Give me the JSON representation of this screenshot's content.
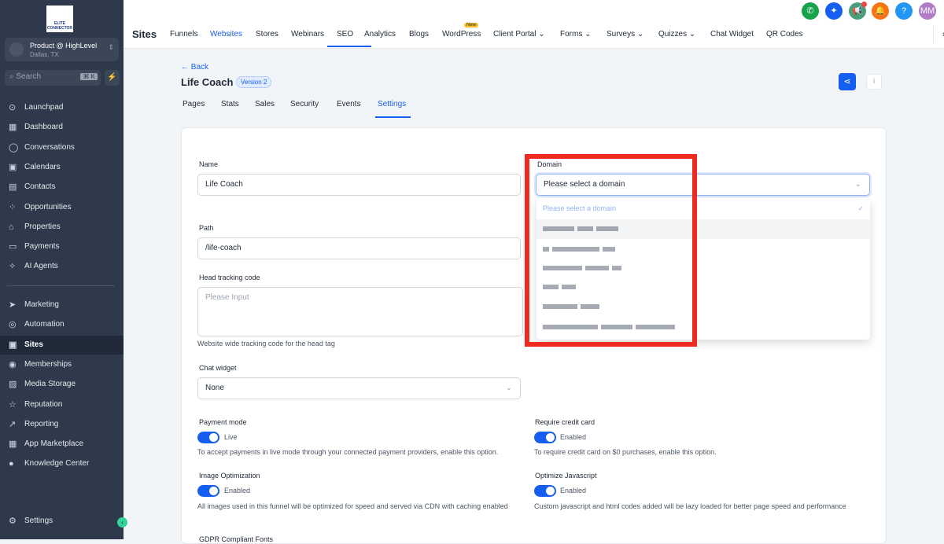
{
  "sidebar": {
    "logo_text": "ELITE CONNECTOR",
    "account": {
      "name": "Product @ HighLevel",
      "location": "Dallas, TX"
    },
    "search": {
      "placeholder": "Search",
      "shortcut": "⌘ K"
    },
    "items": [
      {
        "label": "Launchpad",
        "icon": "⊙"
      },
      {
        "label": "Dashboard",
        "icon": "▦"
      },
      {
        "label": "Conversations",
        "icon": "◯"
      },
      {
        "label": "Calendars",
        "icon": "▣"
      },
      {
        "label": "Contacts",
        "icon": "▤"
      },
      {
        "label": "Opportunities",
        "icon": "⁘"
      },
      {
        "label": "Properties",
        "icon": "⌂"
      },
      {
        "label": "Payments",
        "icon": "▭"
      },
      {
        "label": "AI Agents",
        "icon": "✧"
      }
    ],
    "items2": [
      {
        "label": "Marketing",
        "icon": "➤"
      },
      {
        "label": "Automation",
        "icon": "◎"
      },
      {
        "label": "Sites",
        "icon": "▣"
      },
      {
        "label": "Memberships",
        "icon": "◉"
      },
      {
        "label": "Media Storage",
        "icon": "▨"
      },
      {
        "label": "Reputation",
        "icon": "☆"
      },
      {
        "label": "Reporting",
        "icon": "↗"
      },
      {
        "label": "App Marketplace",
        "icon": "▦"
      },
      {
        "label": "Knowledge Center",
        "icon": "●"
      }
    ],
    "settings": "Settings"
  },
  "topbar": {
    "title": "Sites",
    "tabs": [
      "Funnels",
      "Websites",
      "Stores",
      "Webinars",
      "SEO",
      "Analytics",
      "Blogs",
      "WordPress",
      "Client Portal ⌄",
      "Forms ⌄",
      "Surveys ⌄",
      "Quizzes ⌄",
      "Chat Widget",
      "QR Codes"
    ],
    "new_badge": "New",
    "avatar": "MM"
  },
  "page": {
    "back": "← Back",
    "title": "Life Coach",
    "version": "Version 2",
    "tabs": [
      "Pages",
      "Stats",
      "Sales",
      "Security",
      "Events",
      "Settings"
    ]
  },
  "form": {
    "name_label": "Name",
    "name_value": "Life Coach",
    "domain_label": "Domain",
    "domain_value": "Please select a domain",
    "domain_option": "Please select a domain",
    "path_label": "Path",
    "path_value": "/life-coach",
    "head_label": "Head tracking code",
    "head_placeholder": "Please Input",
    "head_hint": "Website wide tracking code for the head tag",
    "chat_label": "Chat widget",
    "chat_value": "None",
    "payment_label": "Payment mode",
    "payment_state": "Live",
    "payment_hint": "To accept payments in live mode through your connected payment providers, enable this option.",
    "cc_label": "Require credit card",
    "cc_state": "Enabled",
    "cc_hint": "To require credit card on $0 purchases, enable this option.",
    "img_label": "Image Optimization",
    "img_state": "Enabled",
    "img_hint": "All images used in this funnel will be optimized for speed and served via CDN with caching enabled",
    "js_label": "Optimize Javascript",
    "js_state": "Enabled",
    "js_hint": "Custom javascript and html codes added will be lazy loaded for better page speed and performance",
    "gdpr_label": "GDPR Compliant Fonts"
  }
}
